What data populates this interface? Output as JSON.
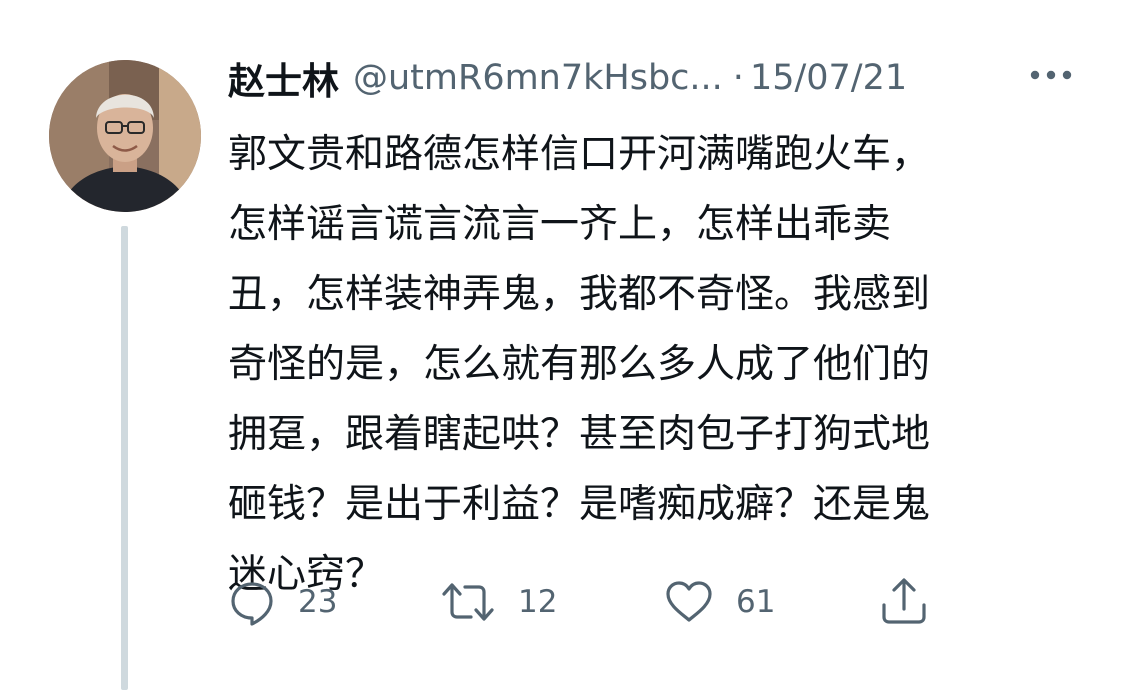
{
  "tweet": {
    "display_name": "赵士林",
    "handle": "@utmR6mn7kHsbc...",
    "separator": "·",
    "date": "15/07/21",
    "text": "郭文贵和路德怎样信口开河满嘴跑火车，\n怎样谣言谎言流言一齐上，怎样出乖卖\n丑，怎样装神弄鬼，我都不奇怪。我感到\n奇怪的是，怎么就有那么多人成了他们的\n拥趸，跟着瞎起哄？甚至肉包子打狗式地\n砸钱？是出于利益？是嗜痴成癖？还是鬼\n迷心窍？"
  },
  "actions": {
    "reply_count": "23",
    "retweet_count": "12",
    "like_count": "61"
  },
  "icons": {
    "more": "more-horizontal-icon",
    "reply": "speech-bubble-icon",
    "retweet": "retweet-arrows-icon",
    "like": "heart-icon",
    "share": "share-upload-icon"
  },
  "colors": {
    "text_primary": "#0f1419",
    "text_secondary": "#536471",
    "thread_line": "#cfd9de"
  }
}
